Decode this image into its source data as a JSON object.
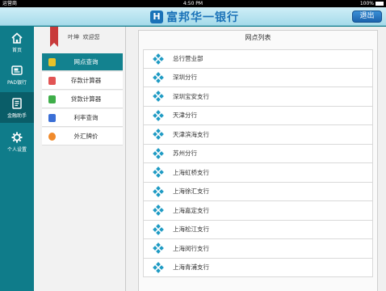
{
  "status_bar": {
    "carrier": "运营商",
    "time": "4:50 PM",
    "battery": "100%"
  },
  "header": {
    "brand_logo_letter": "H",
    "brand_name": "富邦华一银行",
    "exit_label": "退出"
  },
  "left_nav": [
    {
      "label": "首页",
      "icon": "home-icon"
    },
    {
      "label": "PAD银行",
      "icon": "pad-bank-icon"
    },
    {
      "label": "金融助手",
      "icon": "finance-assistant-icon",
      "active": true
    },
    {
      "label": "个人设置",
      "icon": "gear-icon"
    }
  ],
  "middle_panel": {
    "greeting_name": "叶坤",
    "greeting_text": "欢迎您",
    "menu": [
      {
        "label": "网点查询",
        "icon": "location-icon",
        "color": "#e9c229",
        "active": true
      },
      {
        "label": "存款计算器",
        "icon": "deposit-calculator-icon",
        "color": "#e25454"
      },
      {
        "label": "贷款计算器",
        "icon": "loan-calculator-icon",
        "color": "#3fae49"
      },
      {
        "label": "利率查询",
        "icon": "rate-chart-icon",
        "color": "#3b6fd6"
      },
      {
        "label": "外汇牌价",
        "icon": "fx-rate-icon",
        "color": "#f08a2b"
      }
    ]
  },
  "branch_list": {
    "title": "网点列表",
    "items": [
      "总行营业部",
      "深圳分行",
      "深圳宝安支行",
      "天津分行",
      "天津滨海支行",
      "苏州分行",
      "上海虹桥支行",
      "上海徐汇支行",
      "上海嘉定支行",
      "上海松江支行",
      "上海闵行支行",
      "上海青浦支行"
    ]
  },
  "colors": {
    "accent": "#0f7c8a",
    "brand_blue": "#1a72b8",
    "diamond": "#1f9bc4"
  }
}
